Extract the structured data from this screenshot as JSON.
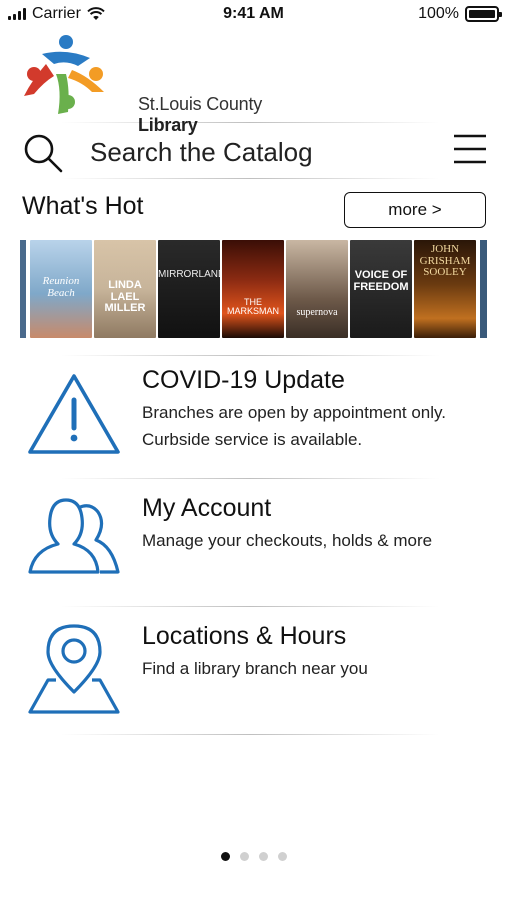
{
  "status_bar": {
    "carrier": "Carrier",
    "time": "9:41 AM",
    "battery": "100%",
    "battery_level": 1.0
  },
  "header": {
    "logo_text_regular": "St.Louis County",
    "logo_text_bold": "Library"
  },
  "search": {
    "placeholder": "Search the Catalog",
    "value": ""
  },
  "whats_hot": {
    "title": "What's Hot",
    "more_label": "more >",
    "covers": [
      {
        "title": "Reunion Beach",
        "bg": "#7fa8c9"
      },
      {
        "title": "LINDA LAEL MILLER",
        "bg": "#c7b49a"
      },
      {
        "title": "MIRRORLAND",
        "bg": "#1a1a1a"
      },
      {
        "title": "THE MARKSMAN",
        "bg": "#8a2a12"
      },
      {
        "title": "supernova",
        "bg": "#6e5a4a"
      },
      {
        "title": "VOICE OF FREEDOM",
        "bg": "#2a2a2a"
      },
      {
        "title": "JOHN GRISHAM SOOLEY",
        "bg": "#6a3a10"
      }
    ]
  },
  "features": [
    {
      "icon": "warning-icon",
      "title": "COVID-19 Update",
      "lines": [
        "Branches are open by appointment only.",
        "Curbside service is available."
      ]
    },
    {
      "icon": "users-icon",
      "title": "My Account",
      "lines": [
        "Manage your checkouts, holds & more"
      ]
    },
    {
      "icon": "location-pin-icon",
      "title": "Locations & Hours",
      "lines": [
        "Find a library branch near you"
      ]
    }
  ],
  "pager": {
    "count": 4,
    "active": 0
  },
  "colors": {
    "icon_blue": "#1f6fb8",
    "logo_blue": "#2a7bc4",
    "logo_red": "#d23a2c",
    "logo_green": "#6ab04c",
    "logo_orange": "#f39c25"
  }
}
